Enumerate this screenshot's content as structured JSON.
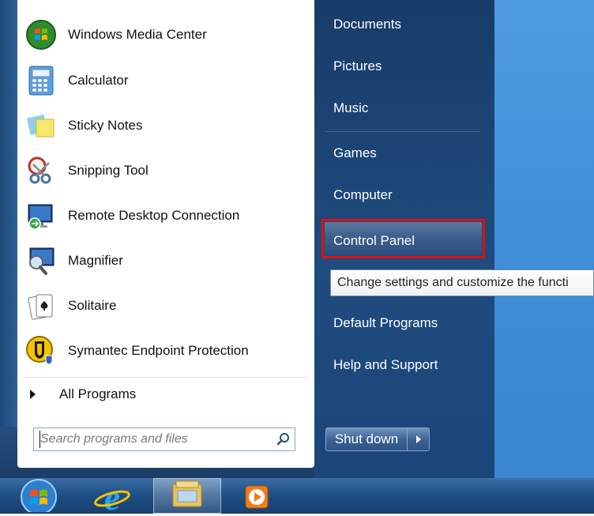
{
  "start_menu": {
    "programs": [
      {
        "label": "Windows Media Center",
        "icon": "windows-media-center-icon"
      },
      {
        "label": "Calculator",
        "icon": "calculator-icon"
      },
      {
        "label": "Sticky Notes",
        "icon": "sticky-notes-icon"
      },
      {
        "label": "Snipping Tool",
        "icon": "snipping-tool-icon"
      },
      {
        "label": "Remote Desktop Connection",
        "icon": "remote-desktop-icon"
      },
      {
        "label": "Magnifier",
        "icon": "magnifier-icon"
      },
      {
        "label": "Solitaire",
        "icon": "solitaire-icon"
      },
      {
        "label": "Symantec Endpoint Protection",
        "icon": "symantec-icon"
      }
    ],
    "all_programs_label": "All Programs",
    "search": {
      "placeholder": "Search programs and files"
    },
    "right_items": [
      {
        "label": "Documents"
      },
      {
        "label": "Pictures"
      },
      {
        "label": "Music"
      },
      {
        "label": "Games"
      },
      {
        "label": "Computer"
      },
      {
        "label": "Control Panel"
      },
      {
        "label": "Default Programs"
      },
      {
        "label": "Help and Support"
      }
    ],
    "tooltip": "Change settings and customize the functi",
    "shutdown_label": "Shut down"
  },
  "taskbar": {
    "items": [
      {
        "name": "start-orb",
        "icon": "windows-orb-icon"
      },
      {
        "name": "internet-explorer",
        "icon": "internet-explorer-icon"
      },
      {
        "name": "windows-explorer",
        "icon": "folder-icon"
      },
      {
        "name": "media-player",
        "icon": "media-player-icon"
      }
    ]
  },
  "colors": {
    "highlight_border": "#e01010",
    "right_panel": "#1f4b7f",
    "desktop": "#3f8fd8"
  }
}
